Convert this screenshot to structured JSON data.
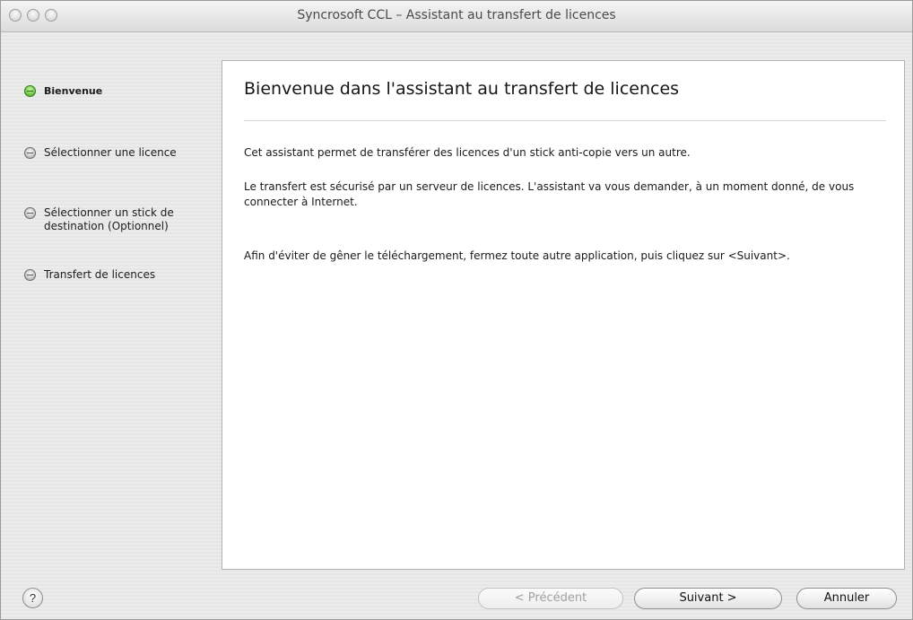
{
  "window": {
    "title": "Syncrosoft CCL – Assistant au transfert de licences"
  },
  "steps": [
    {
      "label": "Bienvenue",
      "active": true
    },
    {
      "label": "Sélectionner une licence",
      "active": false
    },
    {
      "label": "Sélectionner un stick de",
      "label2": "destination (Optionnel)",
      "active": false
    },
    {
      "label": "Transfert de licences",
      "active": false
    }
  ],
  "main": {
    "title": "Bienvenue dans l'assistant au transfert de licences",
    "p1": "Cet assistant permet de transférer des licences d'un stick anti-copie vers un autre.",
    "p2": "Le transfert est sécurisé par un serveur de licences. L'assistant va vous demander, à un moment donné, de vous connecter à Internet.",
    "p3": "Afin d'éviter de gêner le téléchargement, fermez toute autre application, puis cliquez sur <Suivant>."
  },
  "buttons": {
    "help": "?",
    "previous": "< Précédent",
    "next": "Suivant >",
    "cancel": "Annuler"
  },
  "colors": {
    "active_step": "#3fa313"
  }
}
